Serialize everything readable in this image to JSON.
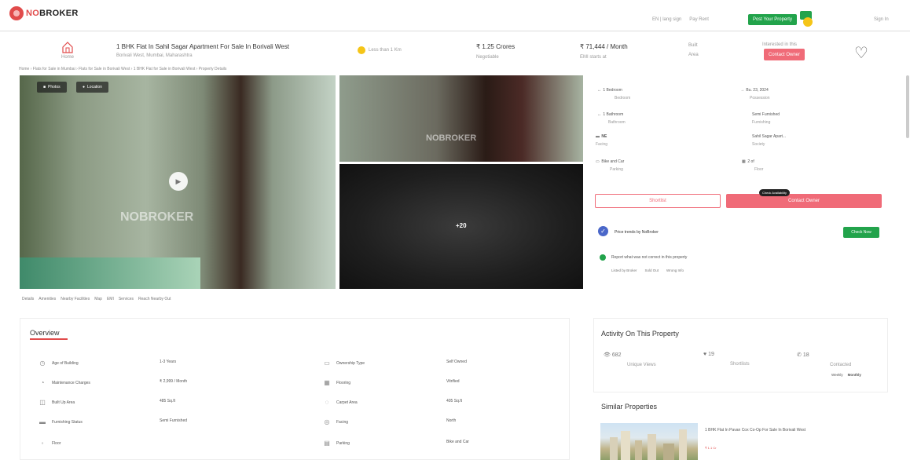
{
  "brand": {
    "name_prefix": "NO",
    "name_suffix": "BROKER"
  },
  "top": {
    "lang": "EN | lang sign",
    "menu": "Pay Rent",
    "post_button": "Post Your Property",
    "user": "Sign In"
  },
  "header": {
    "home_label": "Home",
    "title": "1 BHK Flat In Sahil Sagar Apartment For Sale In Borivali West",
    "subtitle": "Borivali West, Mumbai, Maharashtra",
    "badge": "Less than 1 Km",
    "price_value": "₹ 1.25 Crores",
    "price_label": "Negotiable",
    "emi_value": "₹ 71,444 / Month",
    "emi_label": "EMI starts at",
    "area_value": "Built",
    "area_label": "Area",
    "interested": "Interested in this",
    "contact_label": "Contact Owner"
  },
  "breadcrumb": "Home  ›  Flats for Sale in Mumbai  ›  Flats for Sale in Borivali West  ›  1 BHK Flat for Sale in Borivali West  ›  Property Details",
  "gallery": {
    "photos_label": "Photos",
    "location_label": "Location",
    "watermark": "NOBROKER",
    "more_count": "+20"
  },
  "tabs": [
    "Details",
    "Amenities",
    "Nearby Facilities",
    "Map",
    "EMI",
    "Services",
    "Reach Nearby Out"
  ],
  "details": [
    {
      "icon": "↔",
      "value": "1 Bedroom",
      "label": "Bedroom"
    },
    {
      "icon": "→",
      "value": "Bu. 23, 2024",
      "label": "Possession"
    },
    {
      "icon": "↔",
      "value": "1 Bathroom",
      "label": "Bathroom"
    },
    {
      "icon": "",
      "value": "Semi Furnished",
      "label": "Furnishing"
    },
    {
      "icon": "▬",
      "value": "NE",
      "label": "Facing"
    },
    {
      "icon": "",
      "value": "Sahil Sagar Apart...",
      "label": "Society"
    },
    {
      "icon": "▭",
      "value": "Bike and Car",
      "label": "Parking"
    },
    {
      "icon": "▦",
      "value": "2 of",
      "label": "Floor"
    }
  ],
  "actions": {
    "shortlist": "Shortlist",
    "contact": "Contact Owner",
    "tooltip": "Check Availability"
  },
  "verified": {
    "text": "Price trends by NoBroker",
    "button": "Check Now"
  },
  "report": {
    "text": "Report what was not correct in this property",
    "options": [
      "Listed by Broker",
      "Sold Out",
      "Wrong Info"
    ]
  },
  "overview": {
    "title": "Overview",
    "items": [
      {
        "icon": "◷",
        "label": "Age of Building",
        "value": "1-3 Years"
      },
      {
        "icon": "▭",
        "label": "Ownership Type",
        "value": "Self Owned"
      },
      {
        "icon": "◔",
        "label": "Maintenance Charges",
        "value": "₹ 2,999 / Month"
      },
      {
        "icon": "▦",
        "label": "Flooring",
        "value": "Vitrified"
      },
      {
        "icon": "◫",
        "label": "Built Up Area",
        "value": "485 Sq.ft"
      },
      {
        "icon": "◌",
        "label": "Carpet Area",
        "value": "405 Sq.ft"
      },
      {
        "icon": "▬",
        "label": "Furnishing Status",
        "value": "Semi Furnished"
      },
      {
        "icon": "◎",
        "label": "Facing",
        "value": "North"
      },
      {
        "icon": "◦",
        "label": "Floor",
        "value": ""
      },
      {
        "icon": "▤",
        "label": "Parking",
        "value": "Bike and Car"
      }
    ]
  },
  "activity": {
    "title": "Activity On This Property",
    "stats": [
      {
        "icon": "👁",
        "value": "682",
        "label": "Unique Views"
      },
      {
        "icon": "♥",
        "value": "19",
        "label": "Shortlists"
      },
      {
        "icon": "✆",
        "value": "18",
        "label": "Contacted"
      }
    ],
    "links": [
      "Weekly",
      "Monthly"
    ]
  },
  "similar": {
    "title": "Similar Properties",
    "item_title": "1 BHK Flat In Pavan Cox Co-Op For Sale In Borivali West",
    "item_price": "₹ 1.1 Cr"
  }
}
